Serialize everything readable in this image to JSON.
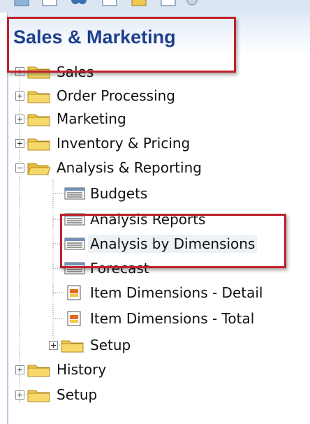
{
  "header": {
    "title": "Sales & Marketing"
  },
  "tree": {
    "items": [
      {
        "label": "Sales",
        "type": "folder",
        "expander": "plus"
      },
      {
        "label": "Order Processing",
        "type": "folder",
        "expander": "plus"
      },
      {
        "label": "Marketing",
        "type": "folder",
        "expander": "plus"
      },
      {
        "label": "Inventory & Pricing",
        "type": "folder",
        "expander": "plus"
      },
      {
        "label": "Analysis & Reporting",
        "type": "folder-open",
        "expander": "minus",
        "children": [
          {
            "label": "Budgets",
            "type": "list-page"
          },
          {
            "label": "Analysis Reports",
            "type": "list-page"
          },
          {
            "label": "Analysis by Dimensions",
            "type": "list-page",
            "selected": true
          },
          {
            "label": "Forecast",
            "type": "list-page"
          },
          {
            "label": "Item Dimensions - Detail",
            "type": "report"
          },
          {
            "label": "Item Dimensions - Total",
            "type": "report"
          },
          {
            "label": "Setup",
            "type": "folder",
            "expander": "plus"
          }
        ]
      },
      {
        "label": "History",
        "type": "folder",
        "expander": "plus"
      },
      {
        "label": "Setup",
        "type": "folder",
        "expander": "plus"
      }
    ]
  },
  "colors": {
    "title": "#1d3f8c",
    "highlight_box": "#c0202c",
    "folder": "#f2c94c"
  }
}
